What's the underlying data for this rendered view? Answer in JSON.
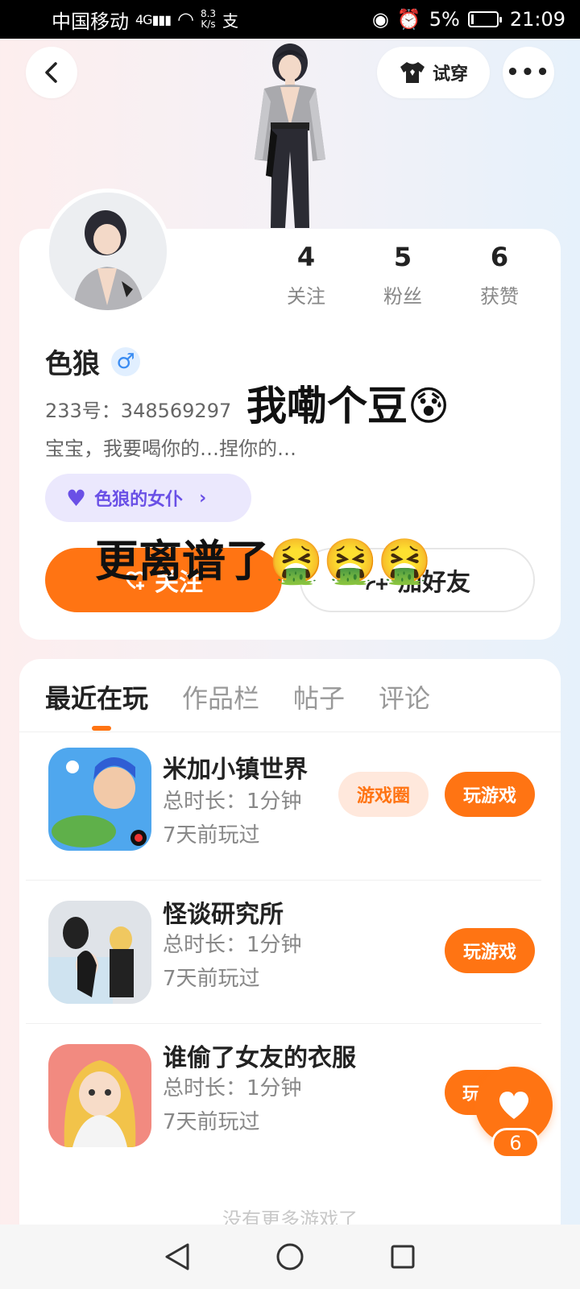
{
  "status_bar": {
    "carrier": "中国移动",
    "signal": "4G",
    "speed_value": "8.3",
    "speed_unit": "K/s",
    "battery": "5%",
    "time": "21:09"
  },
  "header": {
    "tryon_label": "试穿"
  },
  "profile": {
    "stats": [
      {
        "num": "4",
        "label": "关注"
      },
      {
        "num": "5",
        "label": "粉丝"
      },
      {
        "num": "6",
        "label": "获赞"
      }
    ],
    "name": "色狼",
    "gender_symbol": "♂",
    "uid": "233号：348569297",
    "bio": "宝宝，我要喝你的…捏你的…",
    "maid_tag": "色狼的女仆",
    "follow_label": "关注",
    "addfriend_label": "加好友"
  },
  "stickers": {
    "sticker1": "我嘞个豆😰",
    "sticker2": "更离谱了🤮🤮🤮"
  },
  "tabs": [
    {
      "label": "最近在玩"
    },
    {
      "label": "作品栏"
    },
    {
      "label": "帖子"
    },
    {
      "label": "评论"
    }
  ],
  "games": [
    {
      "title": "米加小镇世界",
      "duration": "总时长：1分钟",
      "last_played": "7天前玩过",
      "circle_label": "游戏圈",
      "play_label": "玩游戏"
    },
    {
      "title": "怪谈研究所",
      "duration": "总时长：1分钟",
      "last_played": "7天前玩过",
      "play_label": "玩游戏"
    },
    {
      "title": "谁偷了女友的衣服",
      "duration": "总时长：1分钟",
      "last_played": "7天前玩过",
      "play_label": "玩"
    }
  ],
  "no_more": "没有更多游戏了",
  "like_count": "6",
  "colors": {
    "accent": "#ff7413",
    "purple": "#6a50e6"
  }
}
